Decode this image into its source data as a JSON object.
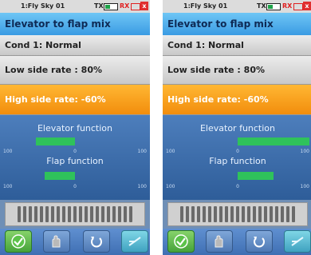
{
  "screens": [
    {
      "status": {
        "model": "1:Fly Sky 01",
        "tx": "TX",
        "rx": "RX",
        "rx_close": "x"
      },
      "title": "Elevator to flap mix",
      "condition": "Cond 1: Normal",
      "low_side": "Low side rate : 80%",
      "high_side": "High side rate: -60%",
      "elevator_label": "Elevator function",
      "flap_label": "Flap function",
      "elevator_value": -0.55,
      "flap_value": -0.42,
      "tick_left": "100",
      "tick_mid": "0",
      "tick_right": "100"
    },
    {
      "status": {
        "model": "1:Fly Sky 01",
        "tx": "TX",
        "rx": "RX",
        "rx_close": "x"
      },
      "title": "Elevator to flap mix",
      "condition": "Cond 1: Normal",
      "low_side": "Low side rate : 80%",
      "high_side": "High side rate: -60%",
      "elevator_label": "Elevator function",
      "flap_label": "Flap function",
      "elevator_value": 1.0,
      "flap_value": 0.5,
      "tick_left": "100",
      "tick_mid": "0",
      "tick_right": "100"
    }
  ],
  "icons": [
    "checkmark-icon",
    "hand-icon",
    "return-icon",
    "extra-icon"
  ],
  "colors": {
    "accent": "#3a9be3",
    "highlight": "#f28d0c",
    "bar": "#2fc25b"
  }
}
